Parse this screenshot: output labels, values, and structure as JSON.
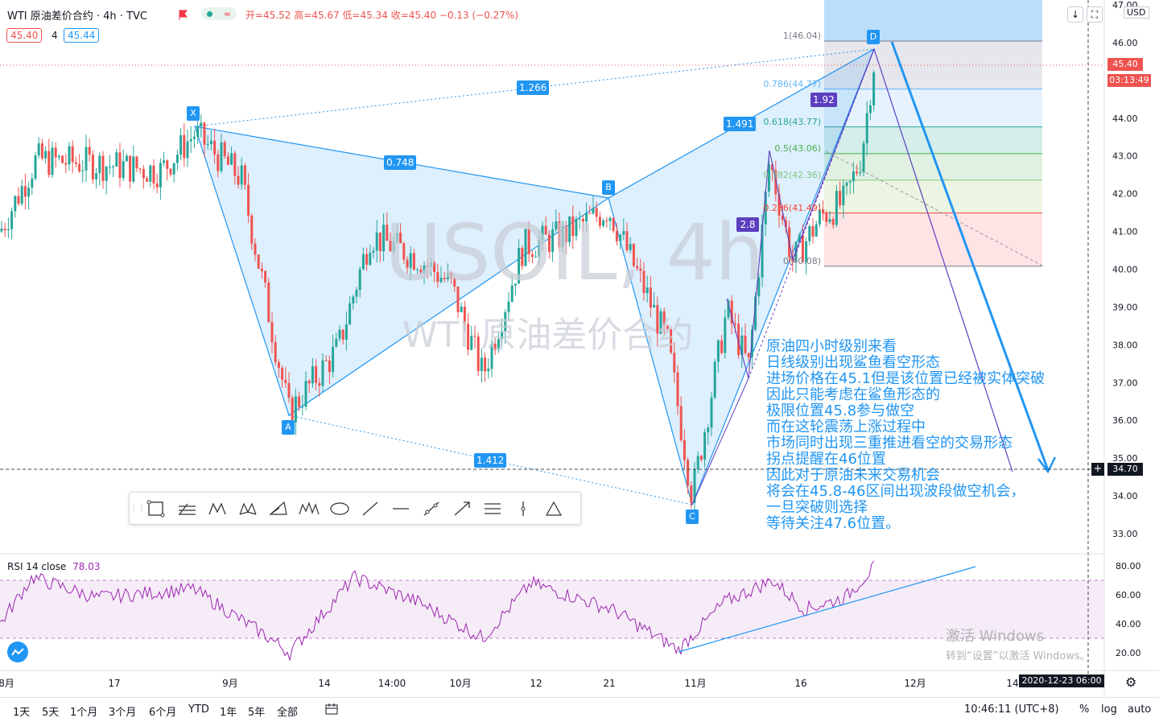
{
  "header": {
    "title": "WTI 原油差价合约 · 4h · TVC",
    "ohlc": "开=45.52 高=45.67 低=45.34 收=45.40 −0.13 (−0.27%)",
    "bid": "45.40",
    "spread": "4",
    "ask": "45.44"
  },
  "watermark": {
    "symbol": "USOIL, 4h",
    "name": "WTI 原油差价合约"
  },
  "chart_data": {
    "type": "candlestick",
    "price_axis": {
      "min": 32.5,
      "max": 47.0,
      "ticks": [
        "47.00",
        "46.00",
        "45.00",
        "44.00",
        "43.00",
        "42.00",
        "41.00",
        "40.00",
        "39.00",
        "38.00",
        "37.00",
        "36.00",
        "35.00",
        "34.00",
        "33.00"
      ],
      "unit": "USD"
    },
    "time_axis_labels": [
      "8月",
      "17",
      "9月",
      "14",
      "14:00",
      "10月",
      "12",
      "21",
      "11月",
      "16",
      "12月",
      "14"
    ],
    "last_price": "45.40",
    "countdown": "03:13:49",
    "crosshair_price": "34.70",
    "crosshair_time": "2020-12-23 06:00",
    "harmonic_pattern": {
      "points": [
        {
          "label": "X",
          "price": 43.8
        },
        {
          "label": "A",
          "price": 36.2
        },
        {
          "label": "B",
          "price": 41.9
        },
        {
          "label": "C",
          "price": 33.8
        },
        {
          "label": "D",
          "price": 45.8
        }
      ],
      "ratios": [
        "1.266",
        "0.748",
        "1.412",
        "1.491",
        "1.92",
        "2.8"
      ]
    },
    "fib_levels": [
      {
        "label": "1(46.04)",
        "price": 46.04
      },
      {
        "label": "0.786(44.77)",
        "price": 44.77
      },
      {
        "label": "0.618(43.77)",
        "price": 43.77
      },
      {
        "label": "0.5(43.06)",
        "price": 43.06
      },
      {
        "label": "0.382(42.36)",
        "price": 42.36
      },
      {
        "label": "0.236(41.49)",
        "price": 41.49
      },
      {
        "label": "0(40.08)",
        "price": 40.08
      }
    ],
    "rsi": {
      "label": "RSI 14 close",
      "value": "78.03",
      "ticks": [
        "80.00",
        "60.00",
        "40.00",
        "20.00"
      ],
      "upper_band": 70,
      "lower_band": 30
    }
  },
  "annotation": [
    "原油四小时级别来看",
    "日线级别出现鲨鱼看空形态",
    "进场价格在45.1但是该位置已经被实体突破",
    "因此只能考虑在鲨鱼形态的",
    "极限位置45.8参与做空",
    "而在这轮震荡上涨过程中",
    "市场同时出现三重推进看空的交易形态",
    "拐点提醒在46位置",
    "因此对于原油未来交易机会",
    "将会在45.8-46区间出现波段做空机会，",
    "一旦突破则选择",
    "等待关注47.6位置。"
  ],
  "windows_watermark": {
    "line1": "激活 Windows",
    "line2": "转到“设置”以激活 Windows。"
  },
  "bottom_bar": {
    "timeframes": [
      "1天",
      "5天",
      "1个月",
      "3个月",
      "6个月",
      "YTD",
      "1年",
      "5年",
      "全部"
    ],
    "clock": "10:46:11 (UTC+8)",
    "percent": "%",
    "log": "log",
    "auto": "auto"
  },
  "colors": {
    "bull": "#26a69a",
    "bear": "#ef5350",
    "pattern": "#2196f3",
    "rsi": "#9c27b0",
    "fib_red": "#f44336",
    "fib_green": "#4caf50"
  }
}
